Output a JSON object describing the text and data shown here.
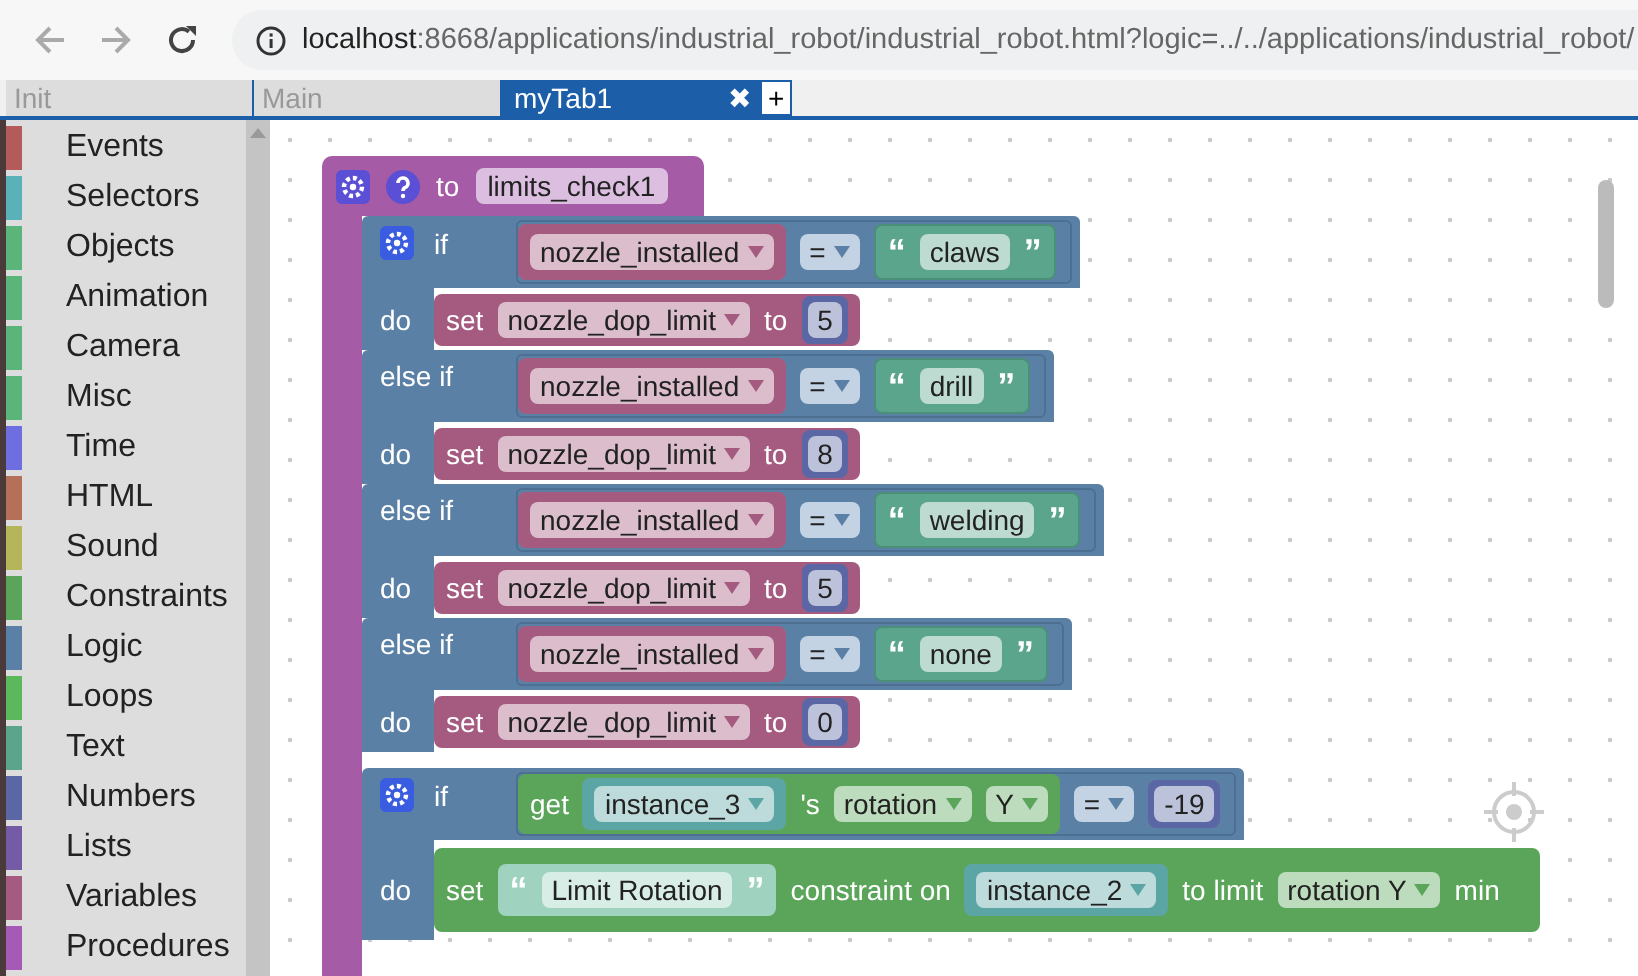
{
  "browser": {
    "host": "localhost",
    "path": ":8668/applications/industrial_robot/industrial_robot.html?logic=../../applications/industrial_robot/"
  },
  "tab_bar": {
    "tabs": [
      {
        "label": "Init",
        "selected": false
      },
      {
        "label": "Main",
        "selected": false
      },
      {
        "label": "myTab1",
        "selected": true
      }
    ],
    "close": "✖",
    "add": "+"
  },
  "toolbox": [
    {
      "label": "Events",
      "color": "#b35a5a"
    },
    {
      "label": "Selectors",
      "color": "#5ab1b8"
    },
    {
      "label": "Objects",
      "color": "#5bb57a"
    },
    {
      "label": "Animation",
      "color": "#5bb57a"
    },
    {
      "label": "Camera",
      "color": "#5bb57a"
    },
    {
      "label": "Misc",
      "color": "#5bb57a"
    },
    {
      "label": "Time",
      "color": "#6e6ee0"
    },
    {
      "label": "HTML",
      "color": "#b5705a"
    },
    {
      "label": "Sound",
      "color": "#b5b55a"
    },
    {
      "label": "Constraints",
      "color": "#5ba55b"
    },
    {
      "label": "Logic",
      "color": "#5b80a5"
    },
    {
      "label": "Loops",
      "color": "#5cb85c"
    },
    {
      "label": "Text",
      "color": "#5ba58c"
    },
    {
      "label": "Numbers",
      "color": "#5b67a5"
    },
    {
      "label": "Lists",
      "color": "#745ba5"
    },
    {
      "label": "Variables",
      "color": "#a55b80"
    },
    {
      "label": "Procedures",
      "color": "#a55bb5"
    }
  ],
  "workspace": {
    "procedure": {
      "keyword": "to",
      "name": "limits_check1",
      "statements": [
        {
          "kind": "if_else",
          "clauses": [
            {
              "keyword": "if",
              "variable": "nozzle_installed",
              "operator": "=",
              "quote_open": "“",
              "text": "claws",
              "quote_close": "”",
              "do": "do",
              "set": "set",
              "target": "nozzle_dop_limit",
              "to": "to",
              "value": "5"
            },
            {
              "keyword": "else if",
              "variable": "nozzle_installed",
              "operator": "=",
              "quote_open": "“",
              "text": "drill",
              "quote_close": "”",
              "do": "do",
              "set": "set",
              "target": "nozzle_dop_limit",
              "to": "to",
              "value": "8"
            },
            {
              "keyword": "else if",
              "variable": "nozzle_installed",
              "operator": "=",
              "quote_open": "“",
              "text": "welding",
              "quote_close": "”",
              "do": "do",
              "set": "set",
              "target": "nozzle_dop_limit",
              "to": "to",
              "value": "5"
            },
            {
              "keyword": "else if",
              "variable": "nozzle_installed",
              "operator": "=",
              "quote_open": "“",
              "text": "none",
              "quote_close": "”",
              "do": "do",
              "set": "set",
              "target": "nozzle_dop_limit",
              "to": "to",
              "value": "0"
            }
          ]
        },
        {
          "kind": "if_rotation",
          "keyword": "if",
          "getter": "get",
          "object": "instance_3",
          "possessive": "'s",
          "property": "rotation",
          "axis": "Y",
          "operator": "=",
          "value": "-19",
          "do": "do",
          "set": "set",
          "quote_open": "“",
          "name": "Limit Rotation",
          "quote_close": "”",
          "constraint_on": "constraint on",
          "target": "instance_2",
          "to_limit": "to limit",
          "limit_property": "rotation Y",
          "min": "min"
        }
      ]
    }
  }
}
